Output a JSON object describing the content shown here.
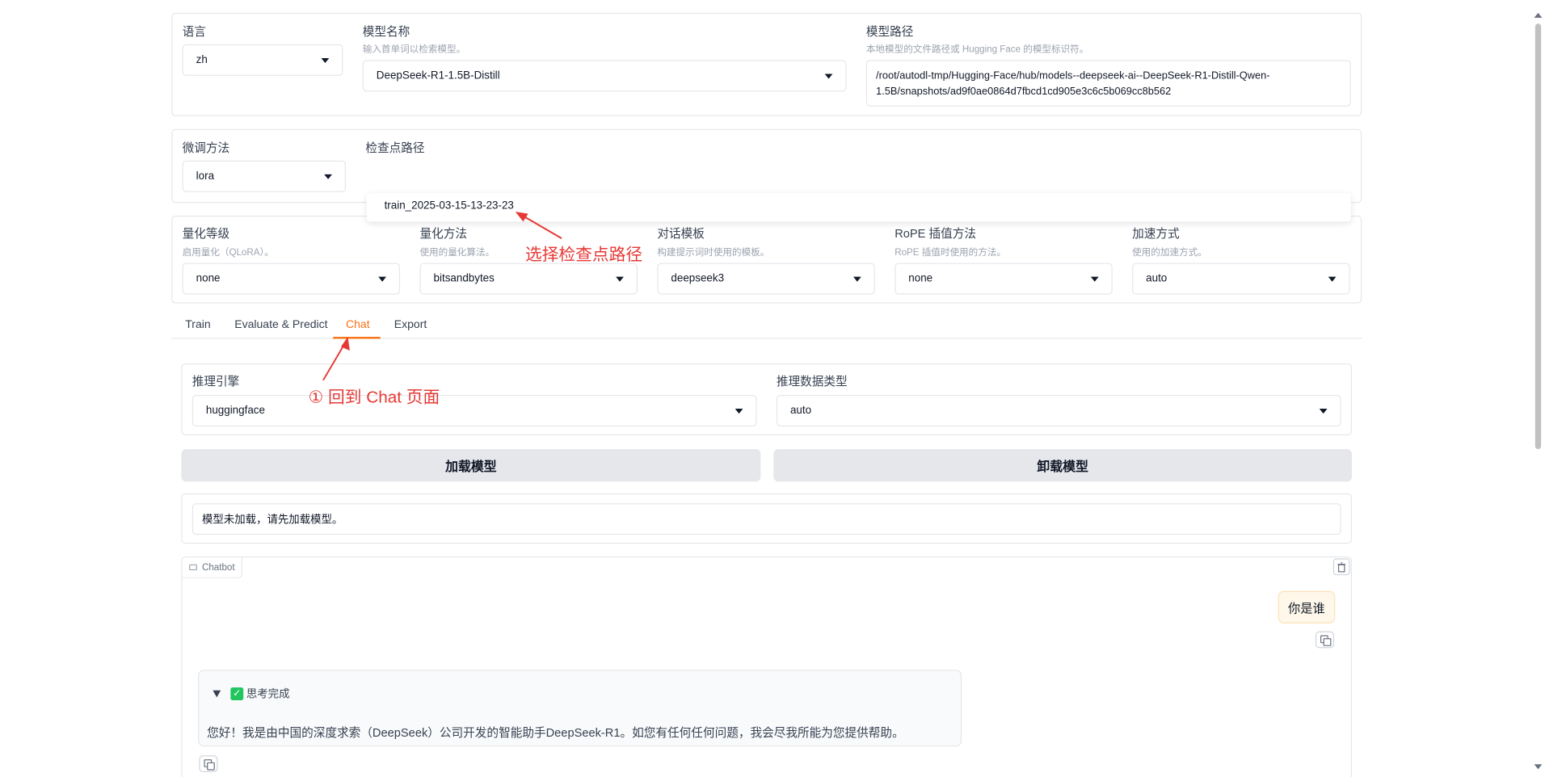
{
  "top_row": {
    "language": {
      "label": "语言",
      "value": "zh"
    },
    "model_name": {
      "label": "模型名称",
      "hint": "输入首单词以检索模型。",
      "value": "DeepSeek-R1-1.5B-Distill"
    },
    "model_path": {
      "label": "模型路径",
      "hint": "本地模型的文件路径或 Hugging Face 的模型标识符。",
      "value_line1": "/root/autodl-tmp/Hugging-Face/hub/models--deepseek-ai--DeepSeek-R1-Distill-Qwen-",
      "value_line2": "1.5B/snapshots/ad9f0ae0864d7fbcd1cd905e3c6c5b069cc8b562"
    }
  },
  "finetune_row": {
    "method": {
      "label": "微调方法",
      "value": "lora"
    },
    "checkpoint": {
      "label": "检查点路径",
      "option": "train_2025-03-15-13-23-23"
    }
  },
  "quant_row": {
    "quant_level": {
      "label": "量化等级",
      "hint": "启用量化（QLoRA）。",
      "value": "none"
    },
    "quant_method": {
      "label": "量化方法",
      "hint": "使用的量化算法。",
      "value": "bitsandbytes"
    },
    "template": {
      "label": "对话模板",
      "hint": "构建提示词时使用的模板。",
      "value": "deepseek3"
    },
    "rope": {
      "label": "RoPE 插值方法",
      "hint": "RoPE 插值时使用的方法。",
      "value": "none"
    },
    "accel": {
      "label": "加速方式",
      "hint": "使用的加速方式。",
      "value": "auto"
    }
  },
  "tabs": [
    "Train",
    "Evaluate & Predict",
    "Chat",
    "Export"
  ],
  "active_tab": "Chat",
  "chat": {
    "engine": {
      "label": "推理引擎",
      "value": "huggingface"
    },
    "dtype": {
      "label": "推理数据类型",
      "value": "auto"
    },
    "load_button": "加载模型",
    "unload_button": "卸载模型",
    "status": "模型未加载，请先加载模型。",
    "chatbot_label": "Chatbot",
    "user_message": "你是谁",
    "thinking_label": "思考完成",
    "assistant_message": "您好！我是由中国的深度求索（DeepSeek）公司开发的智能助手DeepSeek-R1。如您有任何任何问题，我会尽我所能为您提供帮助。"
  },
  "annotations": {
    "select_checkpoint": "选择检查点路径",
    "back_to_chat": "① 回到 Chat 页面"
  },
  "colors": {
    "accent": "#f97316",
    "annotation": "#e53935",
    "button_bg": "#e5e7eb",
    "user_bubble": "#fef7ea"
  }
}
